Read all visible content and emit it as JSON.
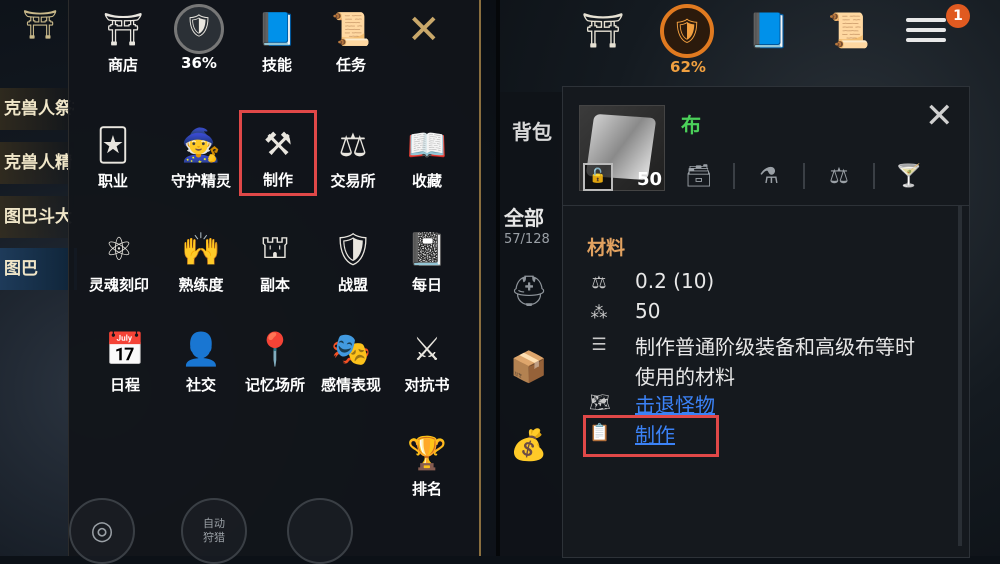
{
  "left": {
    "quests": [
      {
        "text": "克兽人祭祀长",
        "active": false
      },
      {
        "text": "克兽人精",
        "active": false
      },
      {
        "text": "图巴斗大",
        "active": false
      },
      {
        "text": "图巴",
        "active": true
      }
    ],
    "menu": {
      "top_row": [
        {
          "icon": "shop-icon",
          "label": "商店"
        },
        {
          "icon": "gauge-icon",
          "label": "36%"
        },
        {
          "icon": "skill-book-icon",
          "label": "技能"
        },
        {
          "icon": "scroll-icon",
          "label": "任务"
        }
      ],
      "rows": [
        [
          {
            "icon": "class-card-icon",
            "label": "职业"
          },
          {
            "icon": "guardian-spirit-icon",
            "label": "守护精灵"
          },
          {
            "icon": "hammer-wrench-icon",
            "label": "制作",
            "highlight": true
          },
          {
            "icon": "scales-icon",
            "label": "交易所"
          },
          {
            "icon": "open-book-icon",
            "label": "收藏"
          }
        ],
        [
          {
            "icon": "atom-icon",
            "label": "灵魂刻印"
          },
          {
            "icon": "hands-icon",
            "label": "熟练度"
          },
          {
            "icon": "gate-icon",
            "label": "副本"
          },
          {
            "icon": "banner-icon",
            "label": "战盟"
          },
          {
            "icon": "daily-notebook-icon",
            "label": "每日"
          }
        ],
        [
          {
            "icon": "calendar-icon",
            "label": "日程"
          },
          {
            "icon": "person-add-icon",
            "label": "社交"
          },
          {
            "icon": "map-pin-icon",
            "label": "记忆场所"
          },
          {
            "icon": "masks-icon",
            "label": "感情表现"
          },
          {
            "icon": "crossed-swords-icon",
            "label": "对抗书"
          }
        ]
      ],
      "ranking": {
        "icon": "trophy-icon",
        "label": "排名"
      },
      "bottom_buttons": [
        "",
        "自动\n狩猎",
        ""
      ]
    }
  },
  "right": {
    "top_gauge_pct": "62%",
    "notification_count": "1",
    "bag": {
      "title": "背包",
      "filter": "全部",
      "count": "57/128"
    },
    "item": {
      "name": "布",
      "quantity": "50",
      "category": "材料",
      "weight": "0.2 (10)",
      "stack": "50",
      "description_line1": "制作普通阶级装备和高级布等时",
      "description_line2": "使用的材料",
      "source1": "击退怪物",
      "source2": "制作"
    }
  },
  "colors": {
    "highlight": "#e04848",
    "item_name": "#4bd15a",
    "category": "#e2a260",
    "link": "#3b82f6",
    "gauge": "#e07a20"
  }
}
